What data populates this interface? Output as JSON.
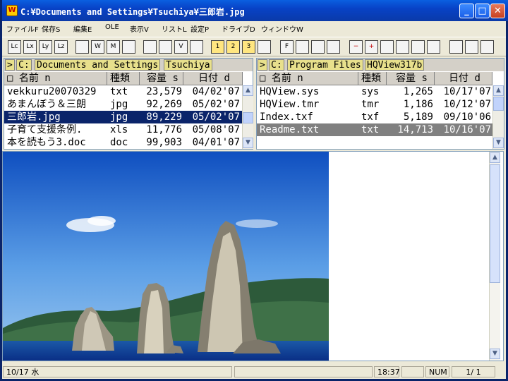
{
  "window": {
    "title": "C:¥Documents and Settings¥Tsuchiya¥三郎岩.jpg"
  },
  "menu": [
    "ファイルF",
    "保存S",
    "編集E",
    "OLE",
    "表示V",
    "リストL",
    "設定P",
    "ドライブD",
    "ウィンドウW"
  ],
  "left_pane": {
    "path": [
      ">",
      "C:",
      "Documents and Settings",
      "Tsuchiya"
    ],
    "headers": [
      "□ 名前 n",
      "種類",
      "容量 s",
      "日付 d"
    ],
    "rows": [
      {
        "name": "vekkuru20070329",
        "type": "txt",
        "size": "23,579",
        "date": "04/02'07"
      },
      {
        "name": "あまんぼう＆三朗",
        "type": "jpg",
        "size": "92,269",
        "date": "05/02'07"
      },
      {
        "name": "三郎岩.jpg",
        "type": "jpg",
        "size": "89,229",
        "date": "05/02'07"
      },
      {
        "name": "子育て支援条例.",
        "type": "xls",
        "size": "11,776",
        "date": "05/08'07"
      },
      {
        "name": "本を読もう3.doc",
        "type": "doc",
        "size": "99,903",
        "date": "04/01'07"
      }
    ]
  },
  "right_pane": {
    "path": [
      ">",
      "C:",
      "Program Files",
      "HQView317b"
    ],
    "headers": [
      "□ 名前 n",
      "種類",
      "容量 s",
      "日付 d"
    ],
    "rows": [
      {
        "name": "HQView.sys",
        "type": "sys",
        "size": "1,265",
        "date": "10/17'07"
      },
      {
        "name": "HQView.tmr",
        "type": "tmr",
        "size": "1,186",
        "date": "10/12'07"
      },
      {
        "name": "Index.txf",
        "type": "txf",
        "size": "5,189",
        "date": "09/10'06"
      },
      {
        "name": "Readme.txt",
        "type": "txt",
        "size": "14,713",
        "date": "10/16'07"
      }
    ]
  },
  "toolbar_icons": [
    "copy-icon",
    "cut-icon",
    "move-icon",
    "paste-icon",
    "view-icon",
    "window-icon",
    "monitor-icon",
    "globe-icon",
    "folder-open-icon",
    "folder-go-icon",
    "check-icon",
    "save-icon",
    "tab1-icon",
    "tab2-icon",
    "tab3-icon",
    "refresh-icon",
    "find-icon",
    "select-icon",
    "mark-icon",
    "mark2-icon",
    "minus-icon",
    "plus-icon",
    "props-icon",
    "props2-icon",
    "props3-icon",
    "props4-icon",
    "copy2-icon",
    "copy3-icon",
    "zoom-icon"
  ],
  "toolbar_labels": [
    "Lc",
    "Lx",
    "Ly",
    "Lz",
    "",
    "W",
    "M",
    "",
    "",
    "",
    "V",
    "",
    "1",
    "2",
    "3",
    "",
    "F",
    "",
    "",
    "",
    "−",
    "+",
    "",
    "",
    "",
    "",
    "",
    "",
    ""
  ],
  "status": {
    "date": "10/17 水",
    "time": "18:37",
    "num": "NUM",
    "page": "1/ 1"
  },
  "colors": {
    "title_bar": "#0842c6",
    "selection": "#0a246a",
    "path_tab": "#e8e08c"
  }
}
